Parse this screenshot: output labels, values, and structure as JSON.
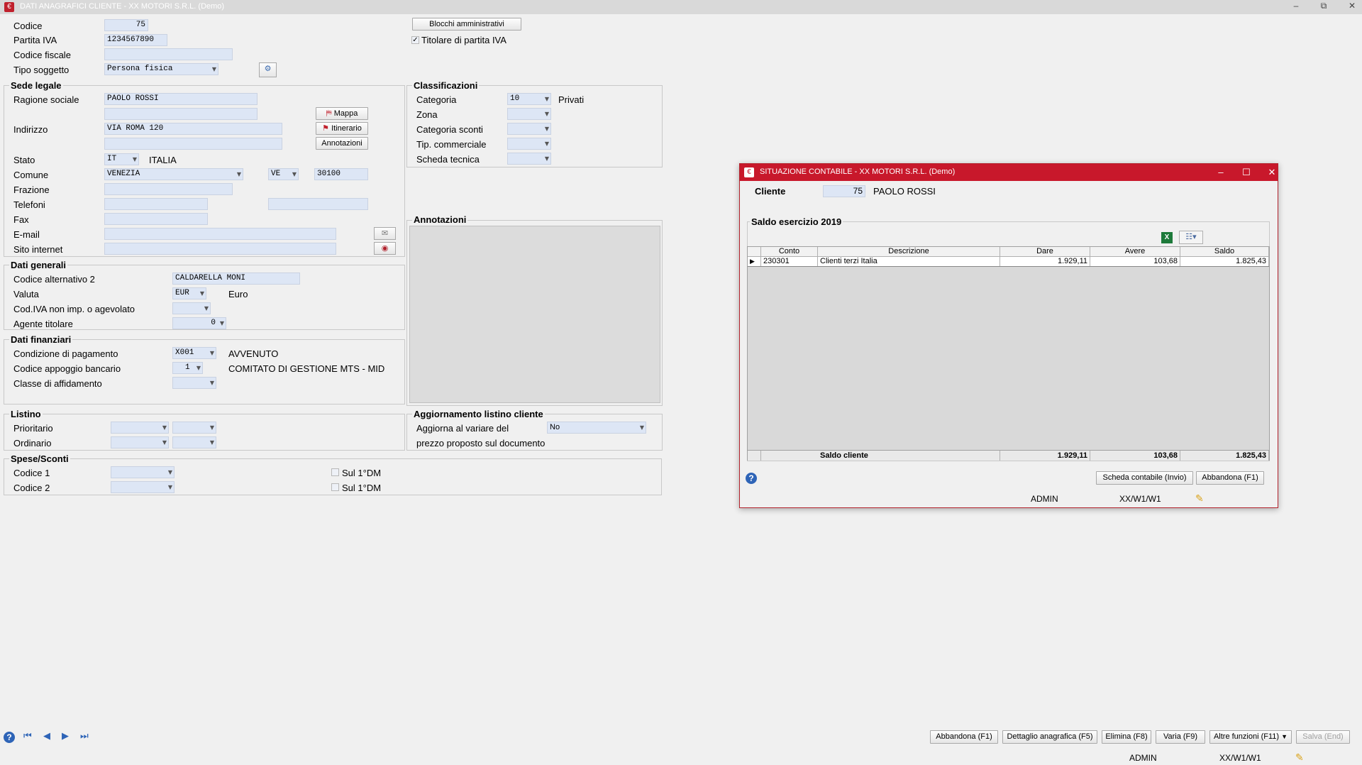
{
  "window": {
    "title": "DATI ANAGRAFICI CLIENTE  - XX  MOTORI S.R.L.  (Demo)",
    "min": "–",
    "restore": "⧉",
    "close": "✕"
  },
  "header": {
    "codice_label": "Codice",
    "codice_value": "75",
    "piva_label": "Partita IVA",
    "piva_value": "1234567890",
    "cf_label": "Codice fiscale",
    "cf_value": "",
    "tipo_label": "Tipo soggetto",
    "tipo_value": "Persona fisica",
    "blocchi_button": "Blocchi amministrativi",
    "titolare_label": "Titolare di partita IVA",
    "titolare_checked": true
  },
  "sede_legale": {
    "title": "Sede legale",
    "ragione_label": "Ragione sociale",
    "ragione_value": "PAOLO ROSSI",
    "ragione_value2": "",
    "indirizzo_label": "Indirizzo",
    "indirizzo_value": "VIA ROMA 120",
    "indirizzo_value2": "",
    "mappa_button": "Mappa",
    "itinerario_button": "Itinerario",
    "annotazioni_button": "Annotazioni",
    "stato_label": "Stato",
    "stato_value": "IT",
    "stato_desc": "ITALIA",
    "comune_label": "Comune",
    "comune_value": "VENEZIA",
    "prov_value": "VE",
    "cap_value": "30100",
    "frazione_label": "Frazione",
    "frazione_value": "",
    "telefoni_label": "Telefoni",
    "tel1_value": "",
    "tel2_value": "",
    "fax_label": "Fax",
    "fax_value": "",
    "email_label": "E-mail",
    "email_value": "",
    "sito_label": "Sito internet",
    "sito_value": ""
  },
  "dati_generali": {
    "title": "Dati generali",
    "cod_alt_label": "Codice alternativo 2",
    "cod_alt_value": "CALDARELLA MONI",
    "valuta_label": "Valuta",
    "valuta_value": "EUR",
    "valuta_desc": "Euro",
    "codiva_label": "Cod.IVA non imp. o agevolato",
    "codiva_value": "",
    "agente_label": "Agente titolare",
    "agente_value": "0"
  },
  "dati_finanziari": {
    "title": "Dati finanziari",
    "cond_label": "Condizione di pagamento",
    "cond_value": "X001",
    "cond_desc": "AVVENUTO",
    "banca_label": "Codice appoggio bancario",
    "banca_value": "1",
    "banca_desc": "COMITATO DI GESTIONE MTS - MID",
    "classe_label": "Classe di affidamento",
    "classe_value": ""
  },
  "listino": {
    "title": "Listino",
    "prioritario_label": "Prioritario",
    "ordinario_label": "Ordinario"
  },
  "spese": {
    "title": "Spese/Sconti",
    "codice1_label": "Codice 1",
    "codice2_label": "Codice 2",
    "sul1_label": "Sul 1°DM",
    "sul2_label": "Sul 1°DM"
  },
  "classificazioni": {
    "title": "Classificazioni",
    "categoria_label": "Categoria",
    "categoria_value": "10",
    "categoria_desc": "Privati",
    "zona_label": "Zona",
    "cat_sconti_label": "Categoria sconti",
    "tip_comm_label": "Tip. commerciale",
    "scheda_label": "Scheda tecnica"
  },
  "annotazioni": {
    "title": "Annotazioni"
  },
  "aggiornamento": {
    "title": "Aggiornamento listino cliente",
    "line1": "Aggiorna al variare del",
    "line2": "prezzo proposto sul documento",
    "value": "No"
  },
  "footer": {
    "abbandona": "Abbandona (F1)",
    "dettaglio": "Dettaglio anagrafica (F5)",
    "elimina": "Elimina (F8)",
    "varia": "Varia (F9)",
    "altre": "Altre funzioni (F11)",
    "salva": "Salva (End)",
    "user": "ADMIN",
    "terminal": "XX/W1/W1"
  },
  "modal": {
    "title": "SITUAZIONE CONTABILE - XX  MOTORI S.R.L.  (Demo)",
    "cliente_label": "Cliente",
    "cliente_code": "75",
    "cliente_name": "PAOLO ROSSI",
    "saldo_title": "Saldo esercizio 2019",
    "columns": [
      "Conto",
      "Descrizione",
      "Dare",
      "Avere",
      "Saldo"
    ],
    "rows": [
      {
        "conto": "230301",
        "descrizione": "Clienti terzi Italia",
        "dare": "1.929,11",
        "avere": "103,68",
        "saldo": "1.825,43"
      }
    ],
    "totals": {
      "label": "Saldo cliente",
      "dare": "1.929,11",
      "avere": "103,68",
      "saldo": "1.825,43"
    },
    "scheda_button": "Scheda contabile (Invio)",
    "abbandona_button": "Abbandona (F1)",
    "user": "ADMIN",
    "terminal": "XX/W1/W1"
  }
}
